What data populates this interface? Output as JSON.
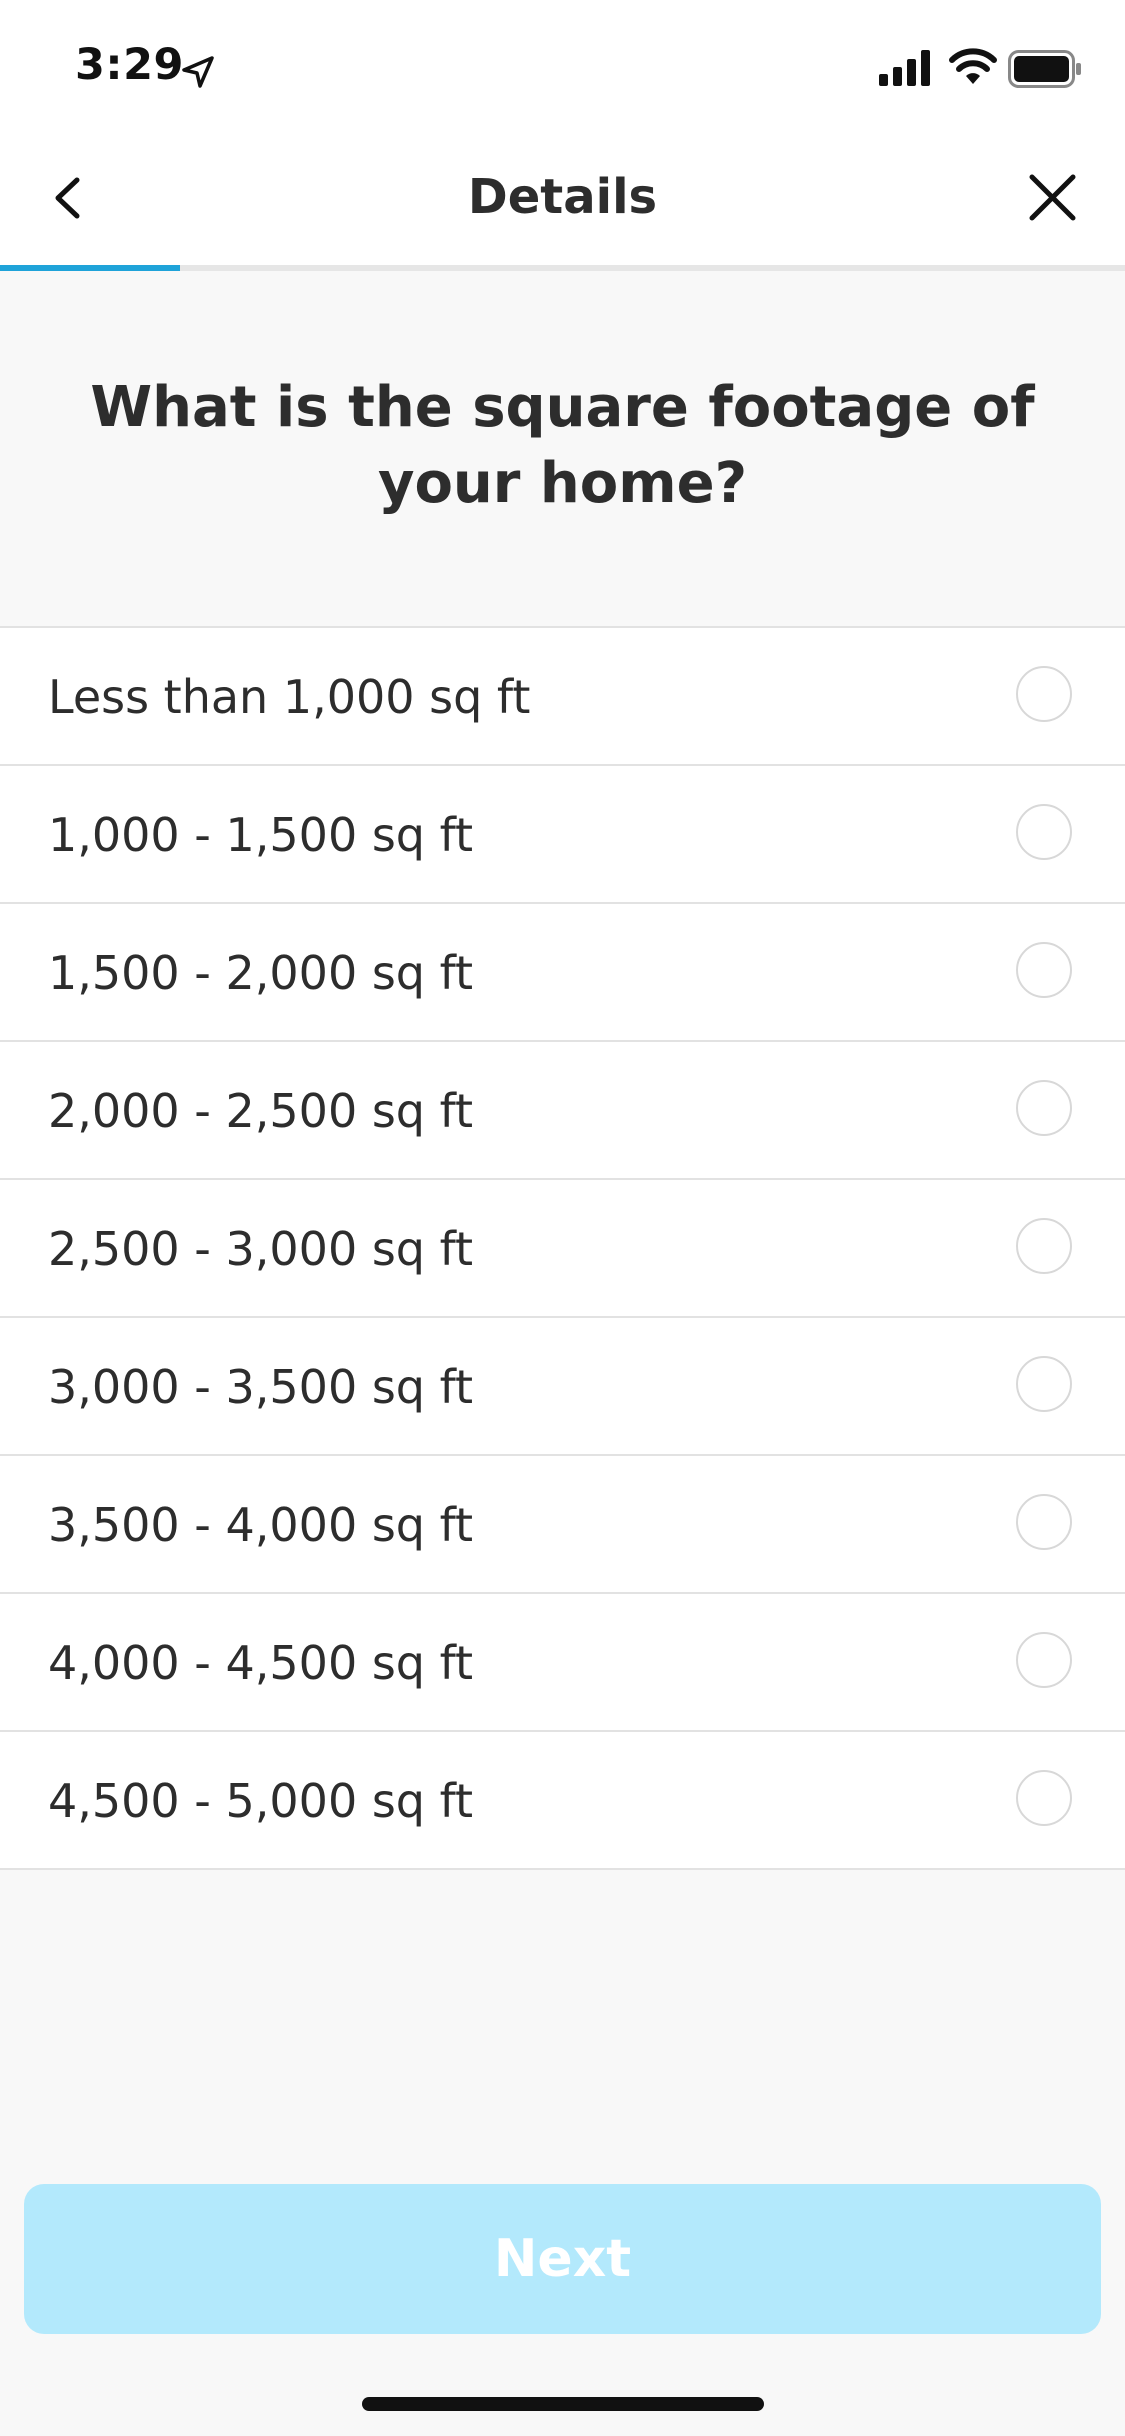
{
  "status_bar": {
    "time": "3:29",
    "location_icon": "location-arrow-icon",
    "signal_icon": "cellular-signal-icon",
    "wifi_icon": "wifi-icon",
    "battery_icon": "battery-icon"
  },
  "nav": {
    "title": "Details",
    "back_icon": "chevron-left-icon",
    "close_icon": "close-icon",
    "progress_fraction": 0.16,
    "progress_color": "#1fa3d9"
  },
  "question": "What is the square footage of your home?",
  "options": [
    {
      "label": "Less than 1,000 sq ft",
      "selected": false
    },
    {
      "label": "1,000 - 1,500 sq ft",
      "selected": false
    },
    {
      "label": "1,500 - 2,000 sq ft",
      "selected": false
    },
    {
      "label": "2,000 - 2,500 sq ft",
      "selected": false
    },
    {
      "label": "2,500 - 3,000 sq ft",
      "selected": false
    },
    {
      "label": "3,000 - 3,500 sq ft",
      "selected": false
    },
    {
      "label": "3,500 - 4,000 sq ft",
      "selected": false
    },
    {
      "label": "4,000 - 4,500 sq ft",
      "selected": false
    },
    {
      "label": "4,500 - 5,000 sq ft",
      "selected": false
    }
  ],
  "next_button": {
    "label": "Next",
    "enabled": false,
    "color": "#b3e9fc"
  }
}
